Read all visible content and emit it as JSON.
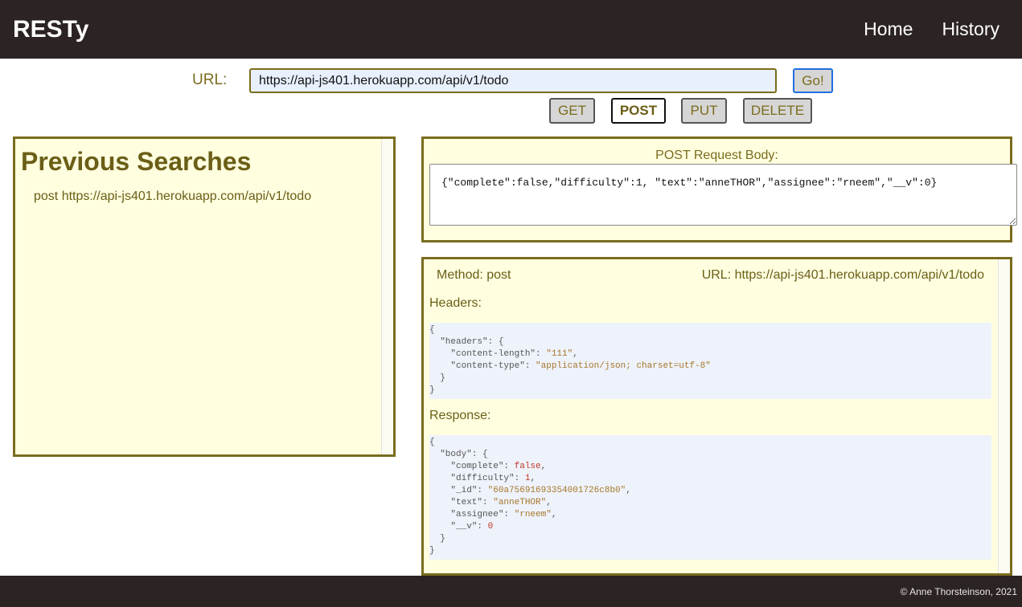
{
  "app": {
    "title": "RESTy"
  },
  "nav": {
    "home": "Home",
    "history": "History"
  },
  "form": {
    "url_label": "URL:",
    "url_value": "https://api-js401.herokuapp.com/api/v1/todo",
    "go_label": "Go!",
    "methods": [
      "GET",
      "POST",
      "PUT",
      "DELETE"
    ],
    "selected_method": "POST"
  },
  "history": {
    "title": "Previous Searches",
    "items": [
      "post https://api-js401.herokuapp.com/api/v1/todo"
    ]
  },
  "request_body": {
    "label": "POST Request Body:",
    "value": "{\"complete\":false,\"difficulty\":1, \"text\":\"anneTHOR\",\"assignee\":\"rneem\",\"__v\":0}"
  },
  "result": {
    "method_text": "Method: post",
    "url_text": "URL: https://api-js401.herokuapp.com/api/v1/todo",
    "headers_label": "Headers:",
    "headers_json": {
      "headers": {
        "content-length": "111",
        "content-type": "application/json; charset=utf-8"
      }
    },
    "response_label": "Response:",
    "response_json": {
      "body": {
        "complete": false,
        "difficulty": 1,
        "_id": "60a75691693354001726c8b0",
        "text": "anneTHOR",
        "assignee": "rneem",
        "__v": 0
      }
    }
  },
  "footer": {
    "text": "© Anne Thorsteinson, 2021"
  },
  "colors": {
    "header_bg": "#2b2422",
    "accent_olive": "#7a6c1e",
    "panel_bg": "#ffffe0",
    "code_bg": "#eef2fa"
  }
}
